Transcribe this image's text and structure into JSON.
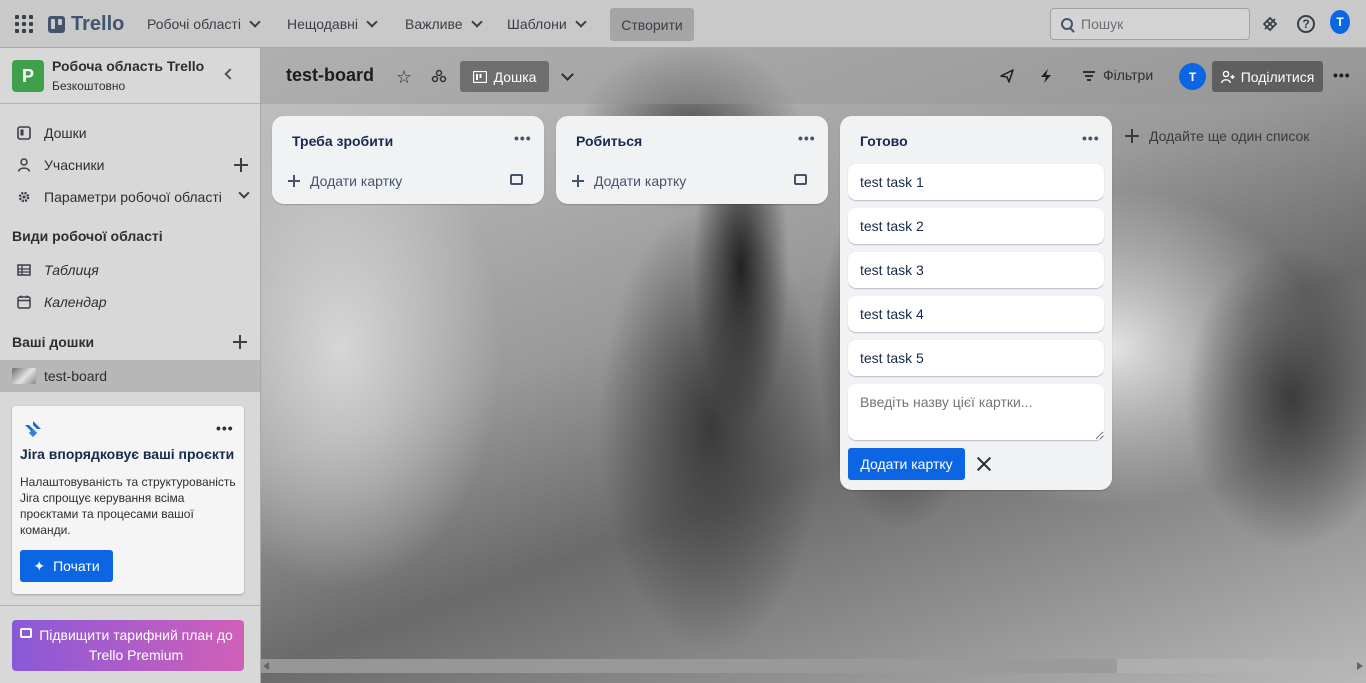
{
  "topnav": {
    "logo": "Trello",
    "menus": [
      "Робочі області",
      "Нещодавні",
      "Важливе",
      "Шаблони"
    ],
    "create_label": "Створити",
    "search_placeholder": "Пошук",
    "avatar_initial": "T"
  },
  "sidebar": {
    "workspace_initial": "P",
    "workspace_name": "Робоча область Trello",
    "workspace_plan": "Безкоштовно",
    "items": [
      {
        "label": "Дошки",
        "icon": "board-icon"
      },
      {
        "label": "Учасники",
        "icon": "person-icon"
      },
      {
        "label": "Параметри робочої області",
        "icon": "gear-icon"
      }
    ],
    "views_title": "Види робочої області",
    "views": [
      {
        "label": "Таблиця",
        "icon": "table-icon"
      },
      {
        "label": "Календар",
        "icon": "calendar-icon"
      }
    ],
    "boards_title": "Ваші дошки",
    "boards": [
      {
        "label": "test-board"
      }
    ],
    "jira": {
      "title": "Jira впорядковує ваші проєкти",
      "text": "Налаштовуваність та структурованість Jira спрощує керування всіма проєктами та процесами вашої команди.",
      "button": "Почати"
    },
    "upgrade_label": "Підвищити тарифний план до Trello Premium"
  },
  "board": {
    "title": "test-board",
    "view_label": "Дошка",
    "filters_label": "Фільтри",
    "avatar_initial": "T",
    "share_label": "Поділитися",
    "add_list_label": "Додайте ще один список",
    "lists": [
      {
        "title": "Треба зробити",
        "add_card_label": "Додати картку",
        "cards": []
      },
      {
        "title": "Робиться",
        "add_card_label": "Додати картку",
        "cards": []
      },
      {
        "title": "Готово",
        "cards": [
          "test task 1",
          "test task 2",
          "test task 3",
          "test task 4",
          "test task 5"
        ],
        "input_placeholder": "Введіть назву цієї картки...",
        "add_button": "Додати картку"
      }
    ]
  },
  "colors": {
    "accent": "#0c66e4",
    "workspace_logo": "#3f9f4a"
  }
}
